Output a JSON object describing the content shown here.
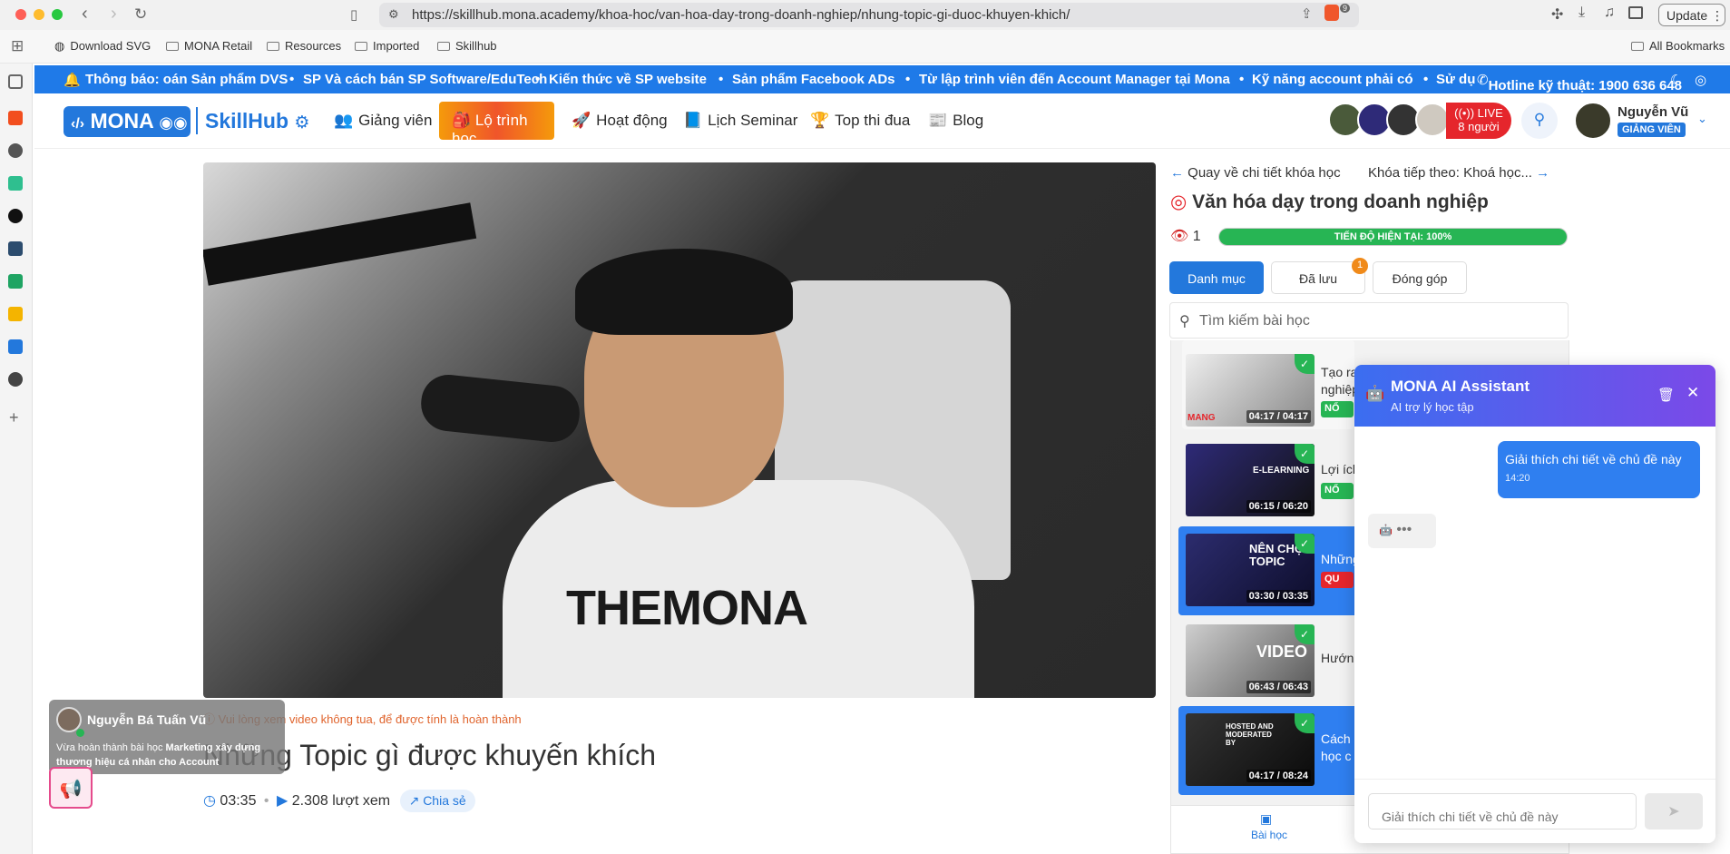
{
  "browser": {
    "url": "https://skillhub.mona.academy/khoa-hoc/van-hoa-day-trong-doanh-nghiep/nhung-topic-gi-duoc-khuyen-khich/",
    "update_label": "Update",
    "extension_badge": "9",
    "bookmarks": [
      "Download SVG",
      "MONA Retail",
      "Resources",
      "Imported",
      "Skillhub"
    ],
    "all_bookmarks": "All Bookmarks"
  },
  "notice": {
    "items": [
      "Thông báo: oán Sản phẩm DVS",
      "•",
      "SP Và cách bán SP Software/EduTech",
      "•",
      "Kiến thức về SP website",
      "•",
      "Sản phẩm Facebook ADs",
      "•",
      "Từ lập trình viên đến Account Manager tại Mona",
      "•",
      "Kỹ năng account phải có",
      "•",
      "Sử dụ"
    ],
    "hotline": "Hotline kỹ thuật: 1900 636 648"
  },
  "header": {
    "logo": "MONA",
    "brand": "SkillHub",
    "menu": [
      "Giảng viên",
      "Lộ trình học",
      "Hoạt động",
      "Lịch Seminar",
      "Top thi đua",
      "Blog"
    ],
    "live_label": "LIVE",
    "live_count": "8 người",
    "user_name": "Nguyễn Vũ",
    "user_role": "GIẢNG VIÊN"
  },
  "video": {
    "shirt_text": "THEMONA",
    "warning": "Vui lòng xem video không tua, để được tính là hoàn thành",
    "title": "Những Topic gì được khuyến khích",
    "duration": "03:35",
    "views": "2.308 lượt xem",
    "share": "Chia sẻ"
  },
  "toast": {
    "name": "Nguyễn Bá Tuấn Vũ",
    "message_prefix": "Vừa hoàn thành bài học",
    "message_bold": "Marketing xây dựng thương hiệu cá nhân cho Account"
  },
  "course": {
    "back": "Quay về chi tiết khóa học",
    "next": "Khóa tiếp theo: Khoá học...",
    "title": "Văn hóa dạy trong doanh nghiệp",
    "views": "1",
    "progress_label": "TIẾN ĐỘ HIỆN TẠI: 100%",
    "progress_value": 1.0,
    "tabs": [
      "Danh mục",
      "Đã lưu",
      "Đóng góp"
    ],
    "saved_count": "1",
    "search_placeholder": "Tìm kiếm bài học",
    "lessons": [
      {
        "time": "04:17 / 04:17",
        "title": "Tạo ra\nnghiệp",
        "tag": "NỔ",
        "tag_color": "#27b554"
      },
      {
        "time": "06:15 / 06:20",
        "title": "Lợi ích",
        "tag": "NỔ",
        "tag_color": "#27b554"
      },
      {
        "time": "03:30 / 03:35",
        "title": "Những",
        "tag": "QU",
        "tag_color": "#e5262c"
      },
      {
        "time": "06:43 / 06:43",
        "title": "Hướng",
        "tag": "",
        "tag_color": ""
      },
      {
        "time": "04:17 / 08:24",
        "title": "Cách\nhọc c",
        "tag": "",
        "tag_color": ""
      }
    ],
    "thumb_captions": [
      "MANG",
      "E-LEARNING",
      "NÊN CHỌN TOPIC",
      "VIDEO",
      "HOSTED AND MODERATED BY"
    ],
    "bottom_tab": "Bài học"
  },
  "chat": {
    "title": "MONA AI Assistant",
    "subtitle": "AI trợ lý học tập",
    "user_message": "Giải thích chi tiết về chủ đề này",
    "message_time": "14:20",
    "input_placeholder": "Giải thích chi tiết về chủ đề này"
  },
  "colors": {
    "brand_blue": "#2378dc",
    "live_red": "#e5262c",
    "progress_green": "#27b554",
    "chat_gradient_start": "#3b6ef0",
    "chat_gradient_end": "#7b49e8"
  }
}
